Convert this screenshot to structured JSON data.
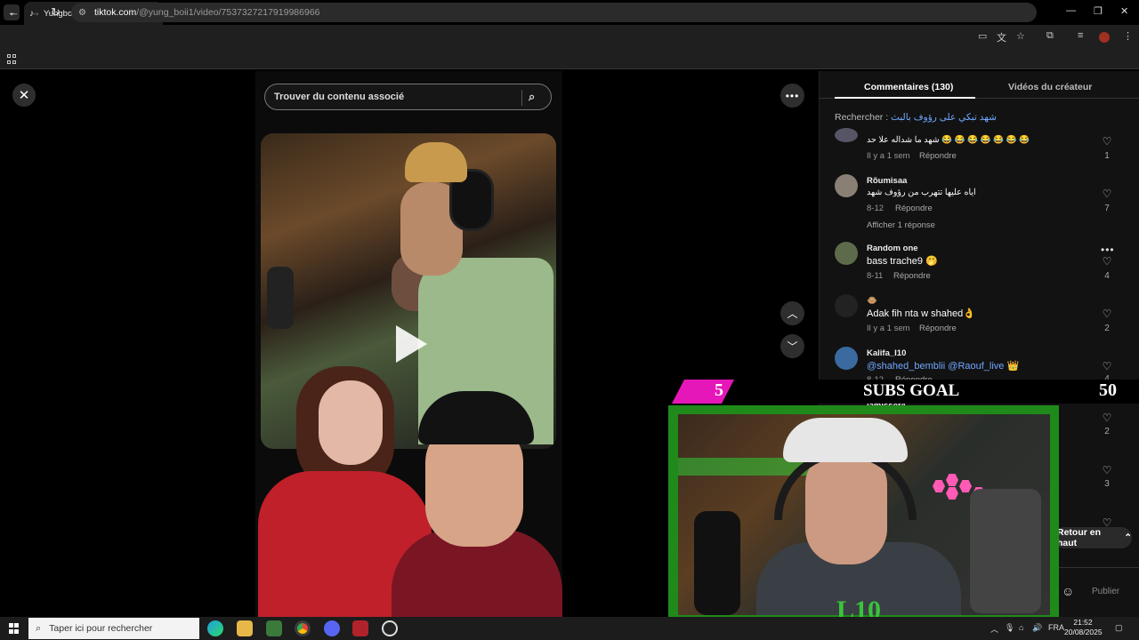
{
  "browser": {
    "tab_title": "Yungboi.Editz (@yung_boii1) | T",
    "url_host": "tiktok.com",
    "url_path": "/@yung_boii1/video/7537327217919986966"
  },
  "player": {
    "search_placeholder": "Trouver du contenu associé"
  },
  "panel": {
    "tabs": [
      {
        "label": "Commentaires (130)"
      },
      {
        "label": "Vidéos du créateur"
      }
    ],
    "search_prefix": "Rechercher :",
    "search_query": "شهد تبكي على رؤوف بالبث",
    "comments": [
      {
        "name": "",
        "text": "شهد ما شداله علا حد 😂 😂 😂 😂 😂 😂 😂",
        "date": "Il y a 1 sem",
        "reply": "Répondre",
        "likes": "1"
      },
      {
        "name": "Rõumisaa",
        "text": "اياه عليها تتهرب من رؤوف شهد",
        "date": "8-12",
        "reply": "Répondre",
        "likes": "7",
        "show_replies": "Afficher 1 réponse"
      },
      {
        "name": "Random one",
        "text": "bass trache9 🤭",
        "date": "8-11",
        "reply": "Répondre",
        "likes": "4"
      },
      {
        "name": "🐵",
        "text": "Adak fih nta w shahed👌",
        "date": "Il y a 1 sem",
        "reply": "Répondre",
        "likes": "2"
      },
      {
        "name": "Kalifa_I10",
        "text_mentions": "@shahed_bemblii @Raouf_live",
        "text_emoji": "👑",
        "date": "8-12",
        "reply": "Répondre",
        "likes": "4"
      },
      {
        "name": "iamisser4",
        "likes": "2"
      },
      {
        "likes": "3"
      }
    ],
    "back_to_top": "Retour en haut",
    "publish": "Publier"
  },
  "overlay": {
    "goal_current": "5",
    "goal_title": "SUBS GOAL",
    "goal_target": "50"
  },
  "taskbar": {
    "search_placeholder": "Taper ici pour rechercher",
    "lang": "FRA",
    "time": "21:52",
    "date": "20/08/2025"
  },
  "colors": {
    "accent_link": "#6fa8ff",
    "goal_pink": "#e617b8",
    "cam_border_green": "#1f8a1a"
  }
}
